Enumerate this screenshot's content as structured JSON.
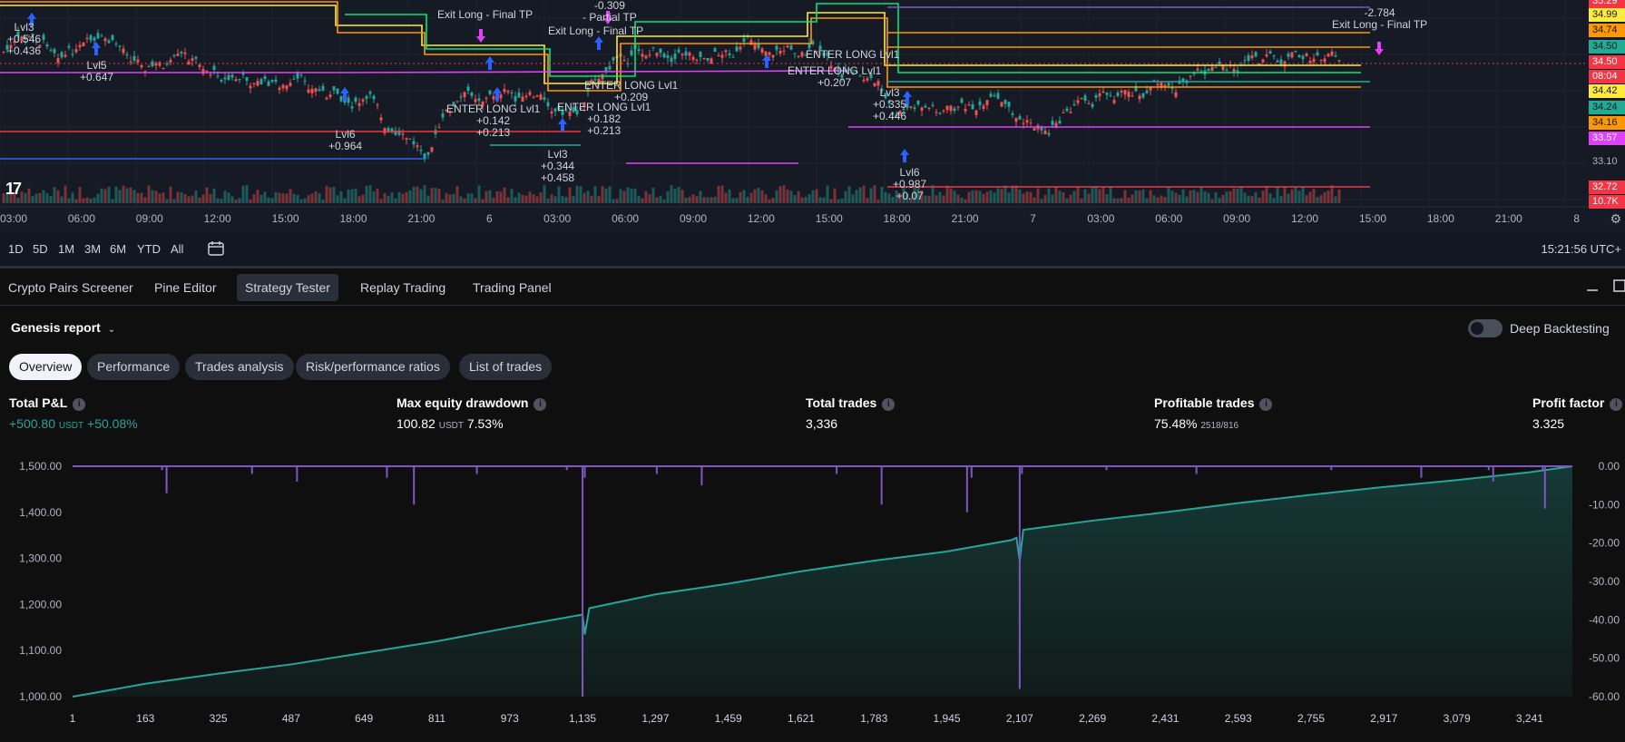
{
  "price_chart": {
    "price_tags": [
      {
        "value": "35.29",
        "color": "#f23645"
      },
      {
        "value": "34.99",
        "color": "#ffeb3b"
      },
      {
        "value": "34.74",
        "color": "#ff9800"
      },
      {
        "value": "34.50",
        "color": "#22ab94"
      },
      {
        "value": "34.50",
        "color": "#f23645"
      },
      {
        "value": "08:04",
        "color": "#f23645"
      },
      {
        "value": "34.42",
        "color": "#ffeb3b"
      },
      {
        "value": "34.24",
        "color": "#22ab94"
      },
      {
        "value": "34.16",
        "color": "#ff9800"
      },
      {
        "value": "33.57",
        "color": "#e040fb"
      },
      {
        "value": "33.10",
        "color": "none"
      },
      {
        "value": "32.72",
        "color": "#f23645"
      },
      {
        "value": "10.7K",
        "color": "#f23645"
      }
    ],
    "time_axis": [
      "03:00",
      "06:00",
      "09:00",
      "12:00",
      "15:00",
      "18:00",
      "21:00",
      "6",
      "03:00",
      "06:00",
      "09:00",
      "12:00",
      "15:00",
      "18:00",
      "21:00",
      "7",
      "03:00",
      "06:00",
      "09:00",
      "12:00",
      "15:00",
      "18:00",
      "21:00",
      "8"
    ],
    "annotations": {
      "a1": "Lvl3\n+0.546\n+0.436",
      "a2": "Lvl5\n+0.647",
      "a3": "Lvl6\n+0.964",
      "a4": "Exit Long - Final TP",
      "a5": "-0.309\n- Partial TP",
      "a6": "Exit Long - Final TP",
      "a7": "ENTER LONG Lvl1\n+0.142\n+0.213",
      "a8": "ENTER LONG Lvl1\n+0.182\n+0.213",
      "a9": "ENTER LONG Lvl1\n+0.209",
      "a10": "Lvl3\n+0.344\n+0.458",
      "a11": "ENTER LONG Lvl1",
      "a12": "ENTER LONG Lvl1\n+0.207",
      "a13": "Lvl3\n+0.335\n+0.446",
      "a14": "Lvl6\n+0.987\n+0.07",
      "a15": "-2.784\nExit Long - Final TP"
    },
    "logo": "17"
  },
  "range_bar": {
    "ranges": [
      "1D",
      "5D",
      "1M",
      "3M",
      "6M",
      "YTD",
      "All"
    ],
    "clock": "15:21:56 UTC+"
  },
  "panel": {
    "tabs": [
      "Crypto Pairs Screener",
      "Pine Editor",
      "Strategy Tester",
      "Replay Trading",
      "Trading Panel"
    ],
    "report_title": "Genesis report",
    "deep_backtesting": "Deep Backtesting",
    "chips": [
      "Overview",
      "Performance",
      "Trades analysis",
      "Risk/performance ratios",
      "List of trades"
    ],
    "metrics": {
      "total_pnl": {
        "label": "Total P&L",
        "value": "+500.80",
        "unit": "USDT",
        "pct": "+50.08%"
      },
      "max_dd": {
        "label": "Max equity drawdown",
        "value": "100.82",
        "unit": "USDT",
        "pct": "7.53%"
      },
      "total_trades": {
        "label": "Total trades",
        "value": "3,336"
      },
      "profitable": {
        "label": "Profitable trades",
        "value": "75.48%",
        "sub": "2518/816"
      },
      "profit_factor": {
        "label": "Profit factor",
        "value": "3.325"
      }
    }
  },
  "chart_data": {
    "type": "area",
    "x_ticks": [
      "1",
      "163",
      "325",
      "487",
      "649",
      "811",
      "973",
      "1,135",
      "1,297",
      "1,459",
      "1,621",
      "1,783",
      "1,945",
      "2,107",
      "2,269",
      "2,431",
      "2,593",
      "2,755",
      "2,917",
      "3,079",
      "3,241"
    ],
    "y_left_ticks": [
      "1,500.00",
      "1,400.00",
      "1,300.00",
      "1,200.00",
      "1,100.00",
      "1,000.00"
    ],
    "y_right_ticks": [
      "0.00",
      "-10.00",
      "-20.00",
      "-30.00",
      "-40.00",
      "-50.00",
      "-60.00"
    ],
    "ylim_left": [
      1000,
      1500
    ],
    "ylim_right": [
      -60,
      0
    ],
    "xlim": [
      1,
      3336
    ],
    "equity": {
      "x": [
        1,
        60,
        163,
        325,
        487,
        649,
        811,
        973,
        1100,
        1135,
        1140,
        1150,
        1297,
        1459,
        1621,
        1783,
        1945,
        2090,
        2100,
        2107,
        2115,
        2269,
        2431,
        2593,
        2755,
        2917,
        3079,
        3241,
        3336
      ],
      "y": [
        1000,
        1010,
        1028,
        1050,
        1070,
        1095,
        1120,
        1150,
        1172,
        1178,
        1135,
        1192,
        1222,
        1245,
        1272,
        1295,
        1315,
        1340,
        1345,
        1295,
        1362,
        1382,
        1400,
        1420,
        1438,
        1455,
        1470,
        1487,
        1500
      ]
    },
    "drawdown": {
      "x": [
        1,
        200,
        210,
        400,
        500,
        700,
        760,
        900,
        1100,
        1135,
        1140,
        1300,
        1400,
        1700,
        1800,
        1990,
        2000,
        2107,
        2112,
        2300,
        2500,
        2800,
        3000,
        3150,
        3160,
        3270,
        3275,
        3336
      ],
      "y": [
        0,
        -1,
        -7,
        -2,
        -4,
        -3,
        -10,
        -2,
        -1,
        -60,
        -3,
        -2,
        -5,
        -2,
        -10,
        -12,
        -3,
        -58,
        -2,
        -1,
        -2,
        -1,
        -3,
        -1,
        -4,
        -1,
        -11,
        0
      ]
    },
    "colors": {
      "equity": "#26a69a",
      "drawdown": "#7e57c2"
    }
  }
}
